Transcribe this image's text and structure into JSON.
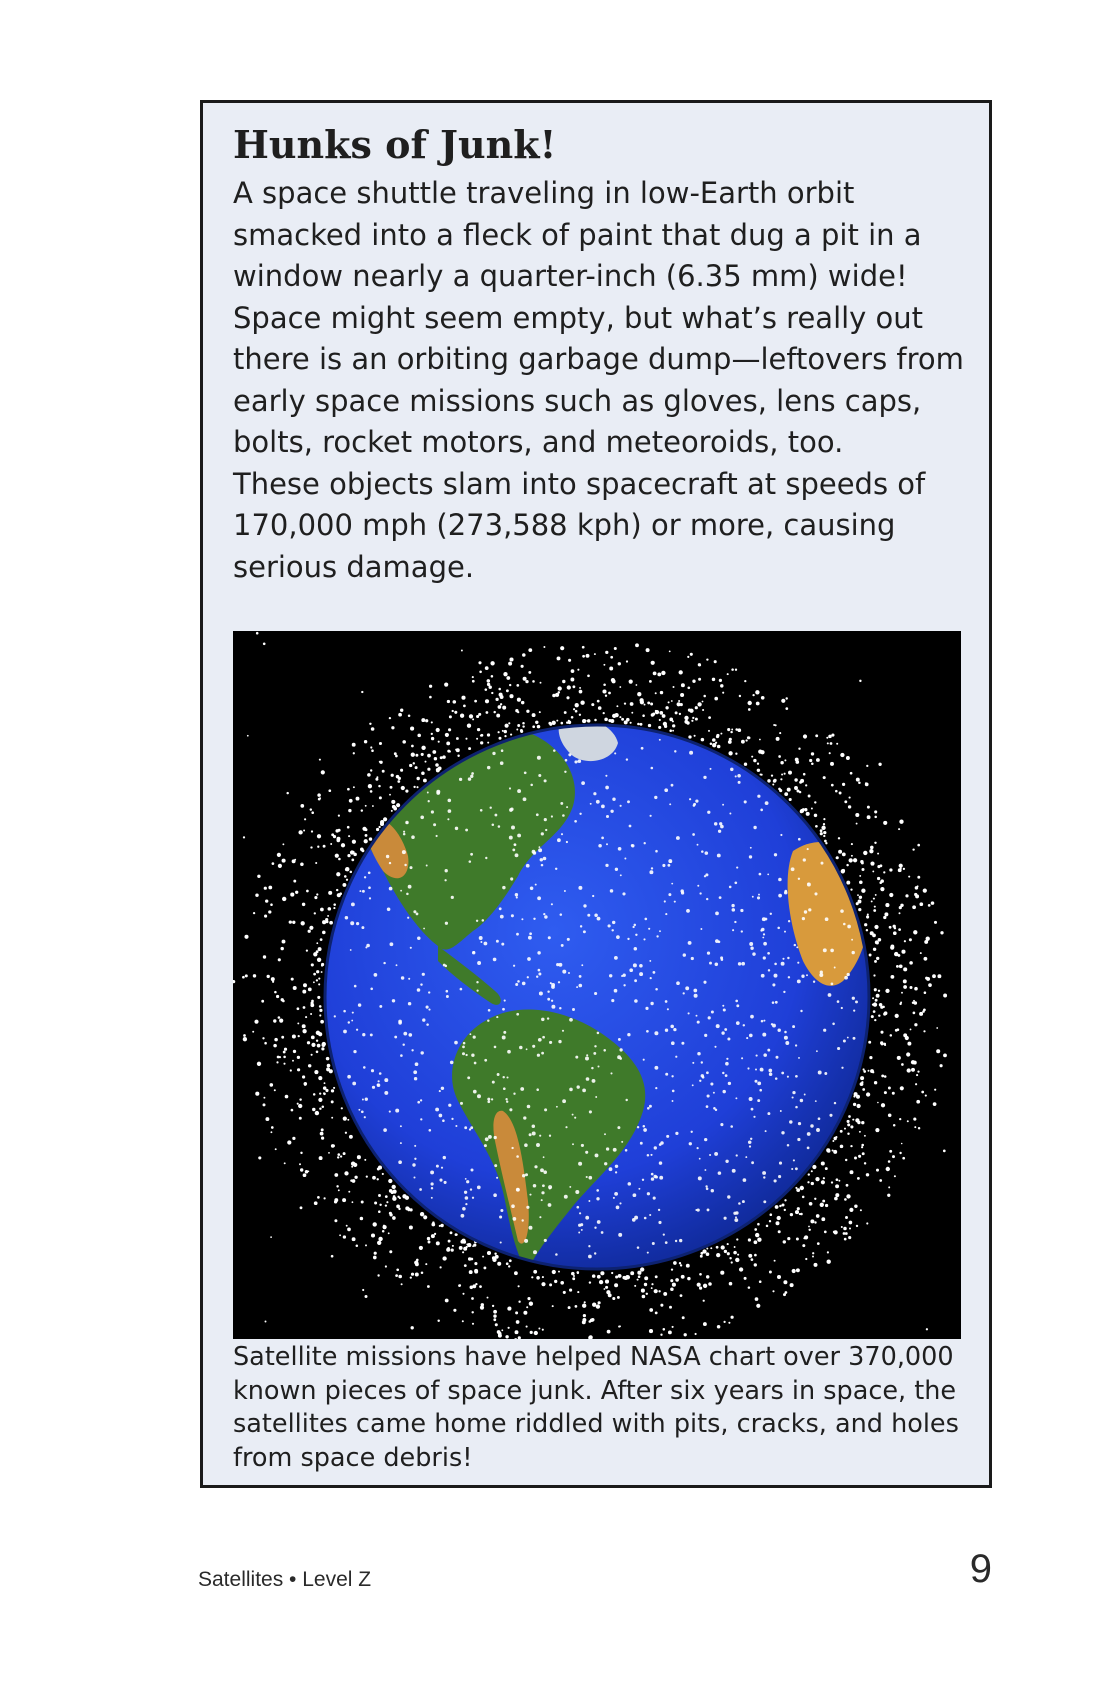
{
  "sidebar": {
    "heading": "Hunks of Junk!",
    "body": "     A space shuttle traveling in low-Earth orbit\nsmacked into a fleck of paint that dug a pit in a\nwindow nearly a quarter-inch (6.35 mm) wide!\nSpace might seem empty, but what’s really out\nthere is an orbiting garbage dump—leftovers from\nearly space missions such as gloves, lens caps,\nbolts, rocket motors, and meteoroids, too.\nThese objects slam into spacecraft at speeds of\n170,000 mph (273,588 kph) or more, causing\nserious damage.",
    "caption": "Satellite missions have helped NASA chart over 370,000 known pieces of space junk. After six years in space, the satellites came home riddled with pits, cracks, and holes from space debris!"
  },
  "figure": {
    "colors": {
      "space": "#000000",
      "ocean": "#1f3fd8",
      "land": "#3f7a2a",
      "desert": "#d89a3c",
      "ice": "#cfd6e0",
      "debris": "#ffffff"
    }
  },
  "footer": {
    "book_label": "Satellites • Level Z",
    "page_number": "9"
  }
}
